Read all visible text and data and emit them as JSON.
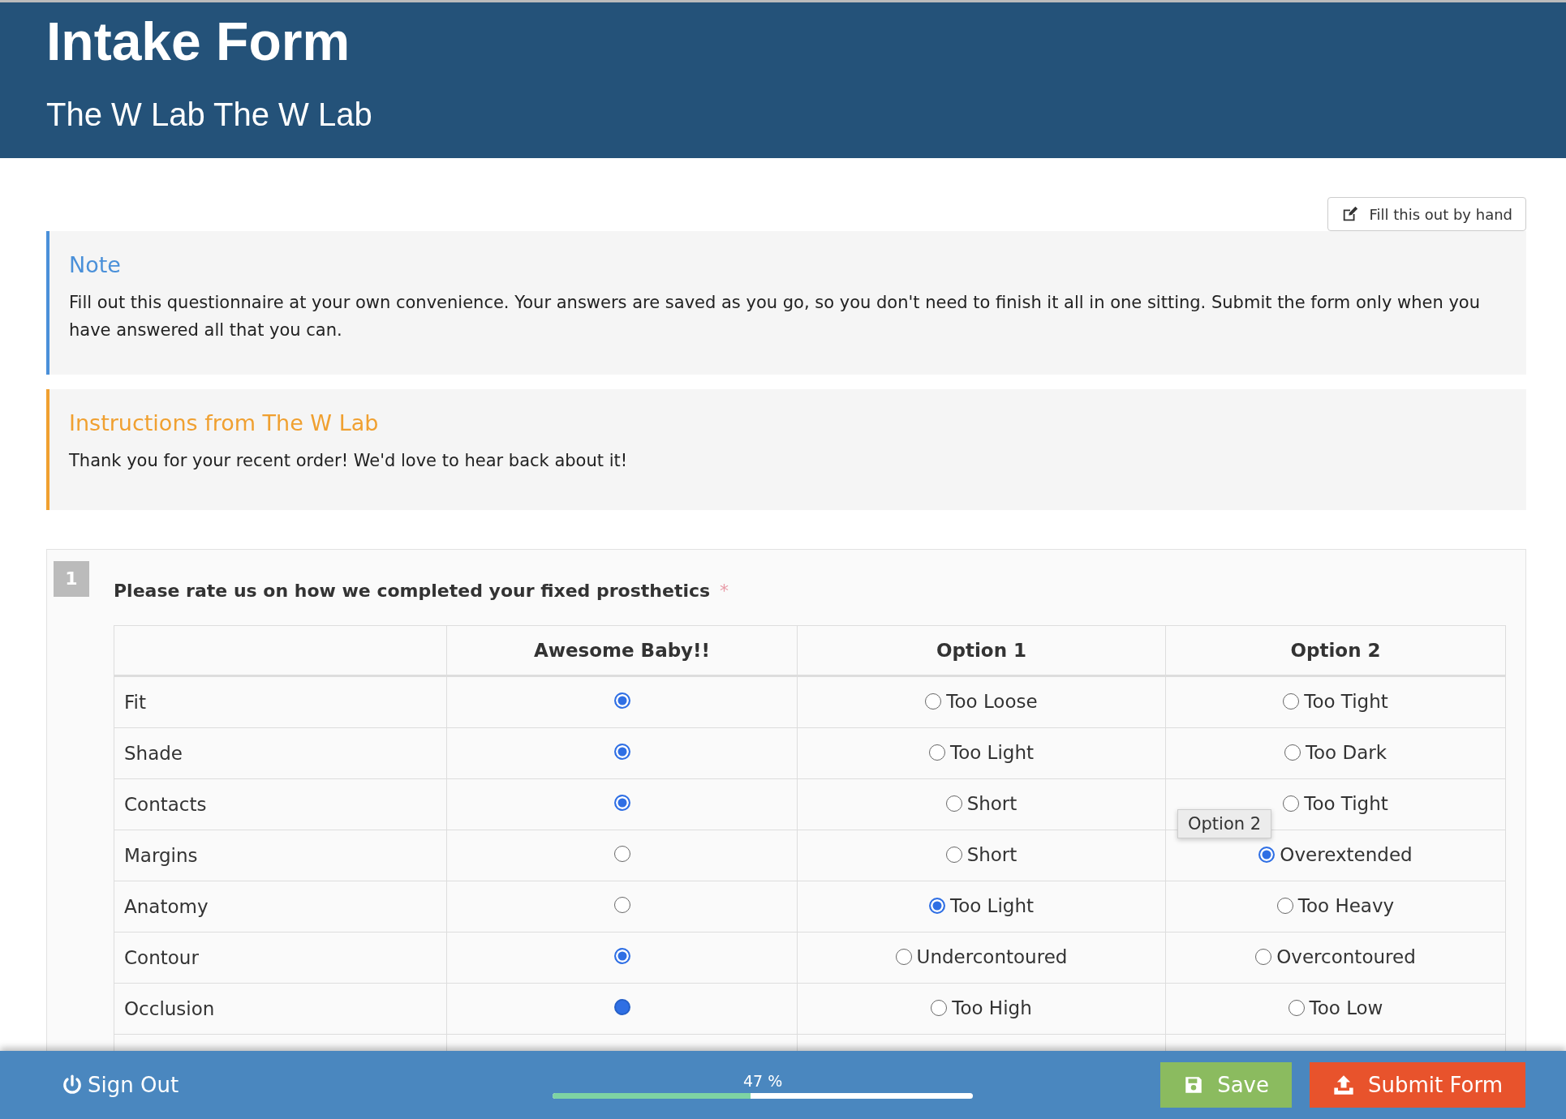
{
  "header": {
    "title": "Intake Form",
    "subtitle": "The W Lab The W Lab"
  },
  "fill_by_hand_button": {
    "label": "Fill this out by hand"
  },
  "notices": [
    {
      "kind": "note",
      "title": "Note",
      "text": "Fill out this questionnaire at your own convenience. Your answers are saved as you go, so you don't need to finish it all in one sitting. Submit the form only when you have answered all that you can."
    },
    {
      "kind": "instructions",
      "title": "Instructions from The W Lab",
      "text": "Thank you for your recent order! We'd love to hear back about it!"
    }
  ],
  "question": {
    "number": "1",
    "text": "Please rate us on how we completed your fixed prosthetics",
    "required_mark": "*",
    "columns": [
      "Awesome Baby!!",
      "Option 1",
      "Option 2"
    ],
    "rows": [
      {
        "label": "Fit",
        "choices": [
          {
            "selected": true
          },
          {
            "label": "Too Loose",
            "selected": false
          },
          {
            "label": "Too Tight",
            "selected": false
          }
        ]
      },
      {
        "label": "Shade",
        "choices": [
          {
            "selected": true
          },
          {
            "label": "Too Light",
            "selected": false
          },
          {
            "label": "Too Dark",
            "selected": false
          }
        ]
      },
      {
        "label": "Contacts",
        "choices": [
          {
            "selected": true
          },
          {
            "label": "Short",
            "selected": false
          },
          {
            "label": "Too Tight",
            "selected": false,
            "tooltip": "Option 2"
          }
        ]
      },
      {
        "label": "Margins",
        "choices": [
          {
            "selected": false
          },
          {
            "label": "Short",
            "selected": false
          },
          {
            "label": "Overextended",
            "selected": true
          }
        ]
      },
      {
        "label": "Anatomy",
        "choices": [
          {
            "selected": false
          },
          {
            "label": "Too Light",
            "selected": true
          },
          {
            "label": "Too Heavy",
            "selected": false
          }
        ]
      },
      {
        "label": "Contour",
        "choices": [
          {
            "selected": true
          },
          {
            "label": "Undercontoured",
            "selected": false
          },
          {
            "label": "Overcontoured",
            "selected": false
          }
        ]
      },
      {
        "label": "Occlusion",
        "choices": [
          {
            "selected": true,
            "pressed": true
          },
          {
            "label": "Too High",
            "selected": false
          },
          {
            "label": "Too Low",
            "selected": false
          }
        ]
      }
    ]
  },
  "footer": {
    "sign_out": "Sign Out",
    "progress": {
      "reading": "47 %",
      "level": 0.47
    },
    "save": "Save",
    "submit": "Submit Form"
  }
}
